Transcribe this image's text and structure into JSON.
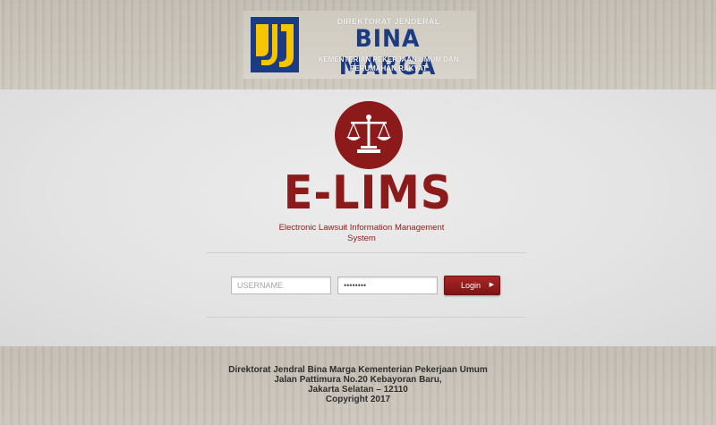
{
  "header": {
    "logo_icon": "pu-logo-icon",
    "org_line": "DIREKTORAT JENDERAL",
    "brand": "BINA MARGA",
    "ministry_line1": "KEMENTERIAN PEKERJAAN UMUM DAN",
    "ministry_line2": "PERUMAHAN RAKYAT",
    "brand_color": "#1b3c85"
  },
  "app": {
    "icon": "scales-of-justice-icon",
    "title": "E-LIMS",
    "subtitle_line1": "Electronic Lawsuit Information Management",
    "subtitle_line2": "System",
    "accent_color": "#8d1a1a"
  },
  "login": {
    "username_placeholder": "USERNAME",
    "username_value": "",
    "password_value": "********",
    "button_label": "Login",
    "button_icon": "triangle-right-icon"
  },
  "footer": {
    "line1": "Direktorat Jendral Bina Marga Kementerian Pekerjaan Umum",
    "line2": "Jalan Pattimura No.20 Kebayoran Baru,",
    "line3": "Jakarta Selatan – 12110",
    "line4": "Copyright 2017"
  }
}
